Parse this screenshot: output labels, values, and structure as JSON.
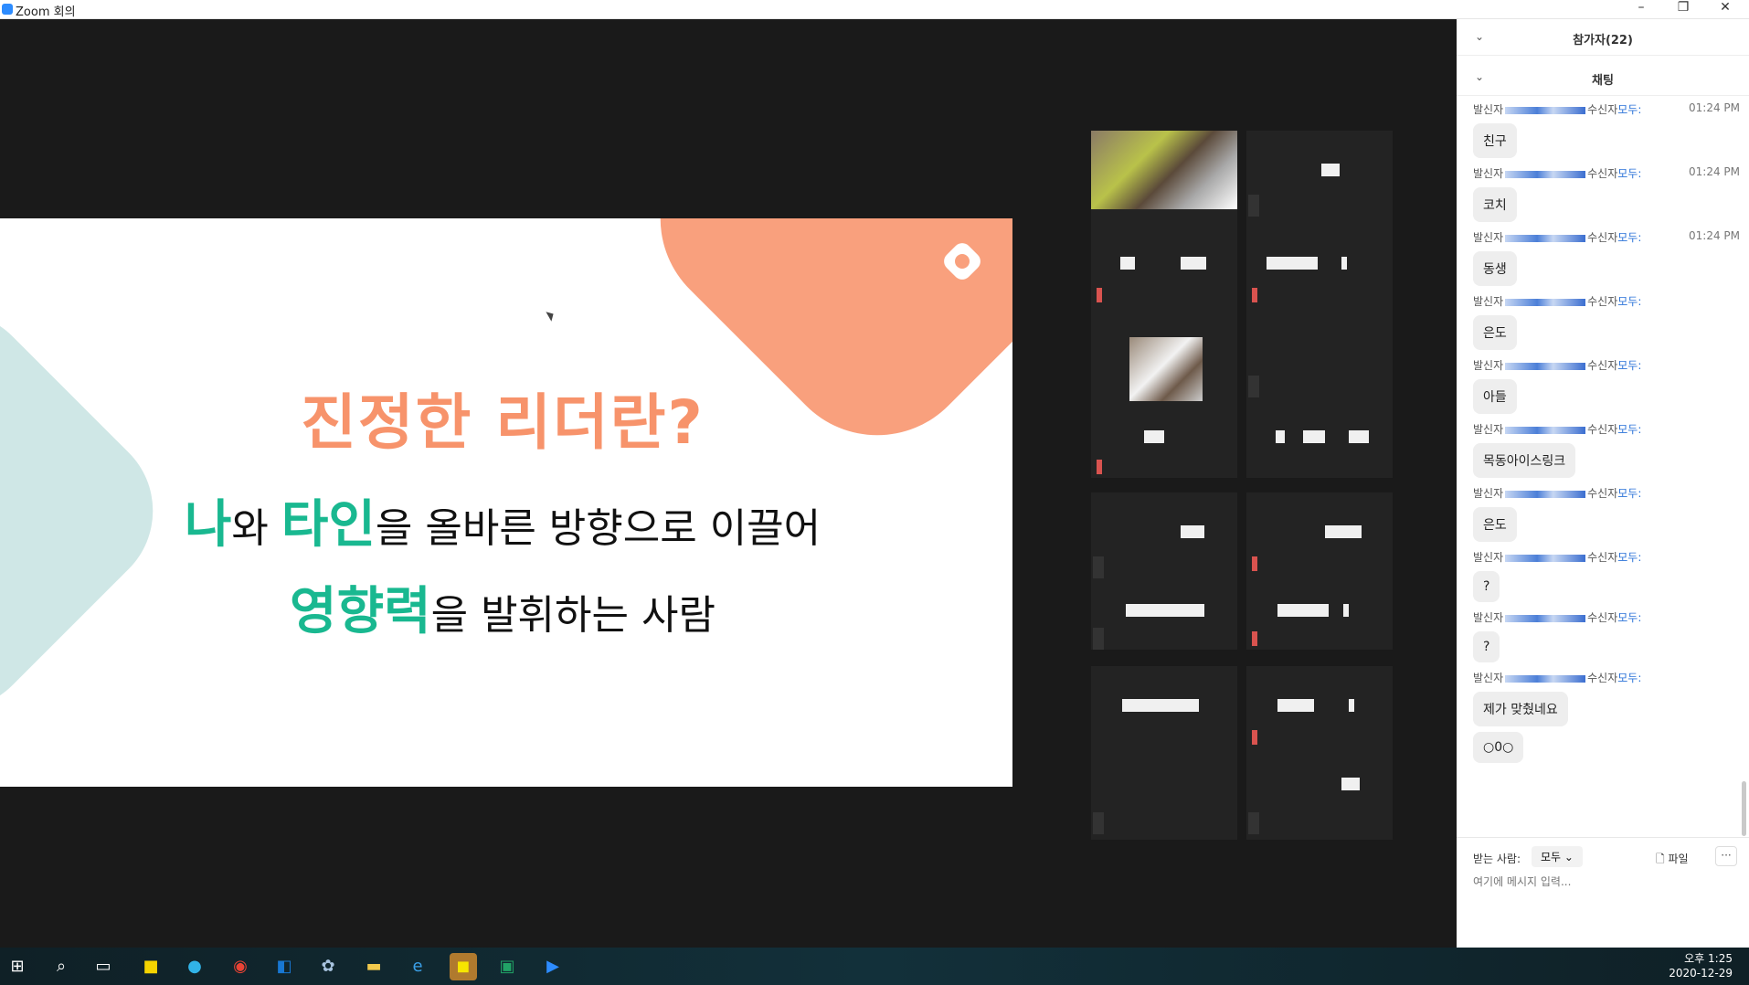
{
  "window": {
    "title": "Zoom 회의"
  },
  "slide": {
    "title": "진정한 리더란?",
    "line1": {
      "hl1": "나",
      "t1": "와 ",
      "hl2": "타인",
      "t2": "을 올바른 방향으로 이끌어"
    },
    "line2": {
      "hl": "영향력",
      "t": "을 발휘하는 사람"
    }
  },
  "panel": {
    "participants_label": "참가자(22)",
    "chat_label": "채팅",
    "from_label": "발신자",
    "to_label": "수신자",
    "to_value": "모두:",
    "messages": [
      {
        "time": "01:24 PM",
        "text": "친구"
      },
      {
        "time": "01:24 PM",
        "text": "코치"
      },
      {
        "time": "01:24 PM",
        "text": "동생"
      },
      {
        "time": "",
        "text": "은도"
      },
      {
        "time": "",
        "text": "아들"
      },
      {
        "time": "",
        "text": "목동아이스링크"
      },
      {
        "time": "",
        "text": "은도"
      },
      {
        "time": "",
        "text": "?"
      },
      {
        "time": "",
        "text": "?"
      },
      {
        "time": "",
        "text": "제가 맞췄네요"
      },
      {
        "time": "",
        "text": "○0○"
      }
    ],
    "compose": {
      "to_label": "받는 사람:",
      "to_value": "모두",
      "file_label": "파일",
      "more_label": "···",
      "placeholder": "여기에 메시지 입력..."
    }
  },
  "taskbar": {
    "clock_time": "오후 1:25",
    "clock_date": "2020-12-29"
  },
  "colors": {
    "accent": "#2d8cff",
    "orange": "#f7936b",
    "teal": "#19b890"
  }
}
